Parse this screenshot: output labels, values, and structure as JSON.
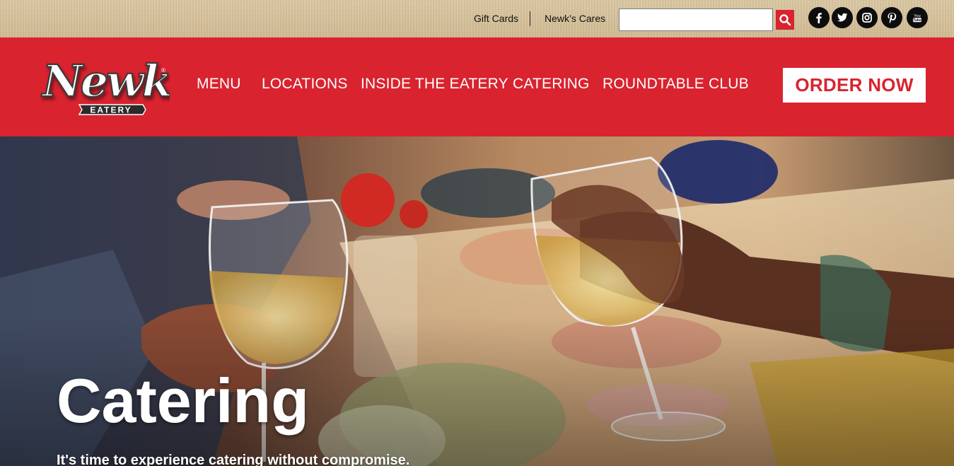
{
  "topbar": {
    "links": [
      {
        "label": "Gift Cards"
      },
      {
        "label": "Newk’s Cares"
      }
    ],
    "search": {
      "placeholder": "",
      "value": "",
      "icon": "search-icon"
    },
    "social": [
      {
        "icon": "facebook-icon"
      },
      {
        "icon": "twitter-icon"
      },
      {
        "icon": "instagram-icon"
      },
      {
        "icon": "pinterest-icon"
      },
      {
        "icon": "youtube-icon",
        "label": "You Tube"
      }
    ]
  },
  "brand": {
    "logo_text": "Newk's",
    "logo_subtext": "EATERY",
    "primary_color": "#d9232f"
  },
  "nav": {
    "items": [
      {
        "label": "MENU"
      },
      {
        "label": "LOCATIONS"
      },
      {
        "label": "INSIDE THE EATERY"
      },
      {
        "label": "CATERING"
      },
      {
        "label": "ROUNDTABLE CLUB"
      }
    ],
    "cta": "ORDER NOW"
  },
  "hero": {
    "title": "Catering",
    "subtitle": "It's time to experience catering without compromise."
  }
}
